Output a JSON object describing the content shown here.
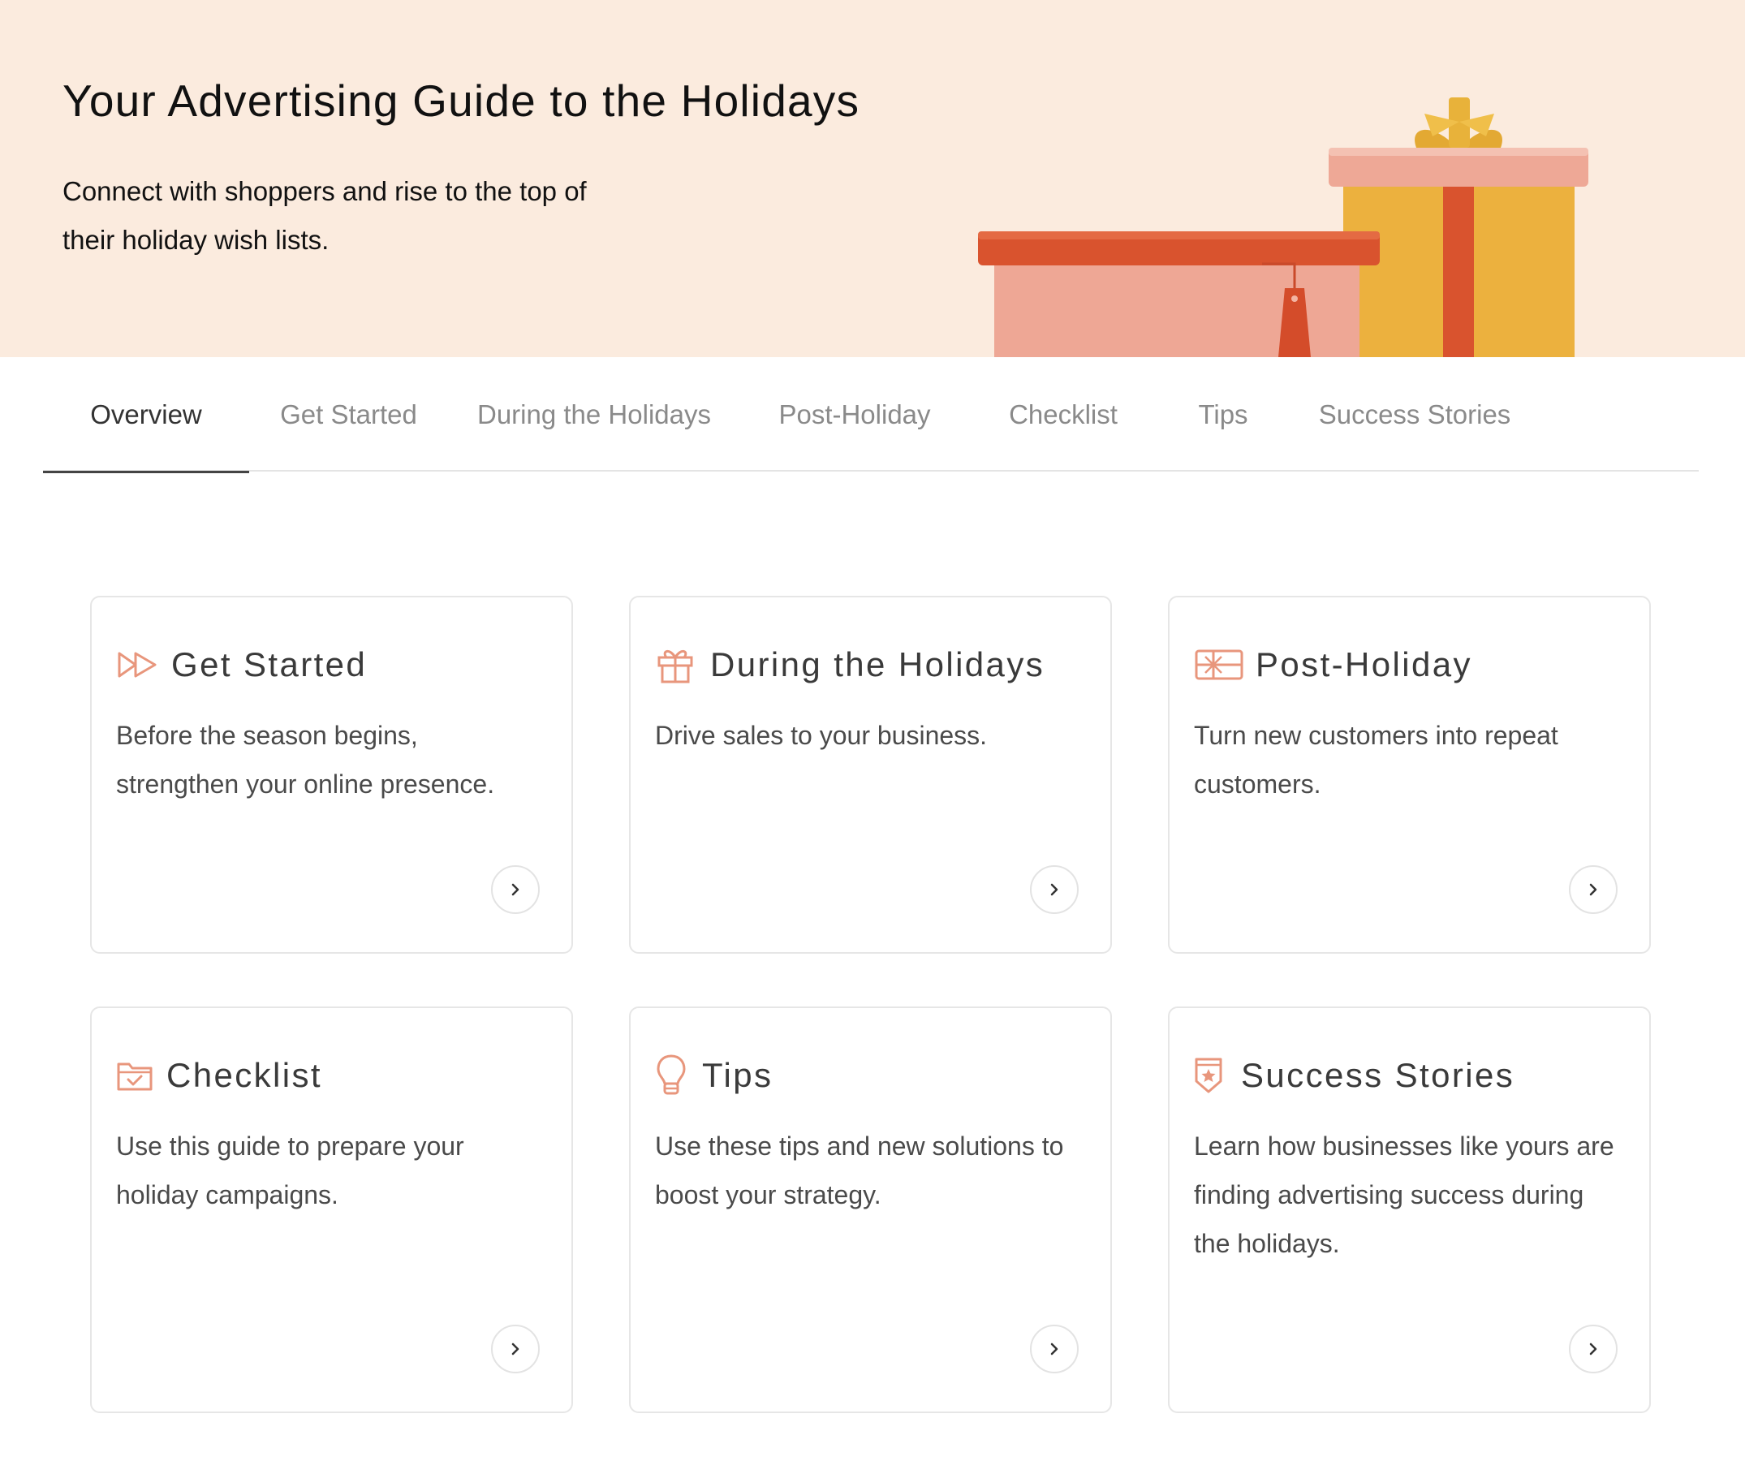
{
  "hero": {
    "title": "Your Advertising Guide to the Holidays",
    "subtitle": "Connect with shoppers and rise to the top of their holiday wish lists."
  },
  "tabs": [
    {
      "label": "Overview",
      "active": true
    },
    {
      "label": "Get Started",
      "active": false
    },
    {
      "label": "During the Holidays",
      "active": false
    },
    {
      "label": "Post-Holiday",
      "active": false
    },
    {
      "label": "Checklist",
      "active": false
    },
    {
      "label": "Tips",
      "active": false
    },
    {
      "label": "Success Stories",
      "active": false
    }
  ],
  "cards": [
    {
      "icon": "fast-forward-icon",
      "title": "Get Started",
      "description": "Before the season begins, strengthen your online presence."
    },
    {
      "icon": "gift-icon",
      "title": "During the Holidays",
      "description": "Drive sales to your business."
    },
    {
      "icon": "gift-card-icon",
      "title": "Post-Holiday",
      "description": "Turn new customers into repeat customers."
    },
    {
      "icon": "folder-check-icon",
      "title": "Checklist",
      "description": "Use this guide to prepare your holiday campaigns."
    },
    {
      "icon": "lightbulb-icon",
      "title": "Tips",
      "description": "Use these tips and new solutions to boost your strategy."
    },
    {
      "icon": "badge-star-icon",
      "title": "Success Stories",
      "description": "Learn how businesses like yours are finding advertising success during the holidays."
    }
  ],
  "colors": {
    "hero_background": "#fbebde",
    "icon_accent": "#e8967c",
    "text_dark": "#111111",
    "tab_inactive": "#8a8a8a"
  }
}
